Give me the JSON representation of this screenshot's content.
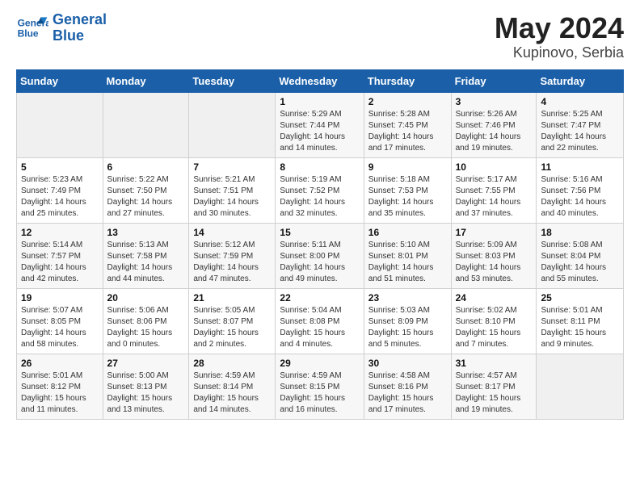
{
  "logo": {
    "name": "GeneralBlue",
    "line1": "General",
    "line2": "Blue"
  },
  "title": "May 2024",
  "subtitle": "Kupinovo, Serbia",
  "days_of_week": [
    "Sunday",
    "Monday",
    "Tuesday",
    "Wednesday",
    "Thursday",
    "Friday",
    "Saturday"
  ],
  "weeks": [
    [
      {
        "day": "",
        "info": ""
      },
      {
        "day": "",
        "info": ""
      },
      {
        "day": "",
        "info": ""
      },
      {
        "day": "1",
        "info": "Sunrise: 5:29 AM\nSunset: 7:44 PM\nDaylight: 14 hours and 14 minutes."
      },
      {
        "day": "2",
        "info": "Sunrise: 5:28 AM\nSunset: 7:45 PM\nDaylight: 14 hours and 17 minutes."
      },
      {
        "day": "3",
        "info": "Sunrise: 5:26 AM\nSunset: 7:46 PM\nDaylight: 14 hours and 19 minutes."
      },
      {
        "day": "4",
        "info": "Sunrise: 5:25 AM\nSunset: 7:47 PM\nDaylight: 14 hours and 22 minutes."
      }
    ],
    [
      {
        "day": "5",
        "info": "Sunrise: 5:23 AM\nSunset: 7:49 PM\nDaylight: 14 hours and 25 minutes."
      },
      {
        "day": "6",
        "info": "Sunrise: 5:22 AM\nSunset: 7:50 PM\nDaylight: 14 hours and 27 minutes."
      },
      {
        "day": "7",
        "info": "Sunrise: 5:21 AM\nSunset: 7:51 PM\nDaylight: 14 hours and 30 minutes."
      },
      {
        "day": "8",
        "info": "Sunrise: 5:19 AM\nSunset: 7:52 PM\nDaylight: 14 hours and 32 minutes."
      },
      {
        "day": "9",
        "info": "Sunrise: 5:18 AM\nSunset: 7:53 PM\nDaylight: 14 hours and 35 minutes."
      },
      {
        "day": "10",
        "info": "Sunrise: 5:17 AM\nSunset: 7:55 PM\nDaylight: 14 hours and 37 minutes."
      },
      {
        "day": "11",
        "info": "Sunrise: 5:16 AM\nSunset: 7:56 PM\nDaylight: 14 hours and 40 minutes."
      }
    ],
    [
      {
        "day": "12",
        "info": "Sunrise: 5:14 AM\nSunset: 7:57 PM\nDaylight: 14 hours and 42 minutes."
      },
      {
        "day": "13",
        "info": "Sunrise: 5:13 AM\nSunset: 7:58 PM\nDaylight: 14 hours and 44 minutes."
      },
      {
        "day": "14",
        "info": "Sunrise: 5:12 AM\nSunset: 7:59 PM\nDaylight: 14 hours and 47 minutes."
      },
      {
        "day": "15",
        "info": "Sunrise: 5:11 AM\nSunset: 8:00 PM\nDaylight: 14 hours and 49 minutes."
      },
      {
        "day": "16",
        "info": "Sunrise: 5:10 AM\nSunset: 8:01 PM\nDaylight: 14 hours and 51 minutes."
      },
      {
        "day": "17",
        "info": "Sunrise: 5:09 AM\nSunset: 8:03 PM\nDaylight: 14 hours and 53 minutes."
      },
      {
        "day": "18",
        "info": "Sunrise: 5:08 AM\nSunset: 8:04 PM\nDaylight: 14 hours and 55 minutes."
      }
    ],
    [
      {
        "day": "19",
        "info": "Sunrise: 5:07 AM\nSunset: 8:05 PM\nDaylight: 14 hours and 58 minutes."
      },
      {
        "day": "20",
        "info": "Sunrise: 5:06 AM\nSunset: 8:06 PM\nDaylight: 15 hours and 0 minutes."
      },
      {
        "day": "21",
        "info": "Sunrise: 5:05 AM\nSunset: 8:07 PM\nDaylight: 15 hours and 2 minutes."
      },
      {
        "day": "22",
        "info": "Sunrise: 5:04 AM\nSunset: 8:08 PM\nDaylight: 15 hours and 4 minutes."
      },
      {
        "day": "23",
        "info": "Sunrise: 5:03 AM\nSunset: 8:09 PM\nDaylight: 15 hours and 5 minutes."
      },
      {
        "day": "24",
        "info": "Sunrise: 5:02 AM\nSunset: 8:10 PM\nDaylight: 15 hours and 7 minutes."
      },
      {
        "day": "25",
        "info": "Sunrise: 5:01 AM\nSunset: 8:11 PM\nDaylight: 15 hours and 9 minutes."
      }
    ],
    [
      {
        "day": "26",
        "info": "Sunrise: 5:01 AM\nSunset: 8:12 PM\nDaylight: 15 hours and 11 minutes."
      },
      {
        "day": "27",
        "info": "Sunrise: 5:00 AM\nSunset: 8:13 PM\nDaylight: 15 hours and 13 minutes."
      },
      {
        "day": "28",
        "info": "Sunrise: 4:59 AM\nSunset: 8:14 PM\nDaylight: 15 hours and 14 minutes."
      },
      {
        "day": "29",
        "info": "Sunrise: 4:59 AM\nSunset: 8:15 PM\nDaylight: 15 hours and 16 minutes."
      },
      {
        "day": "30",
        "info": "Sunrise: 4:58 AM\nSunset: 8:16 PM\nDaylight: 15 hours and 17 minutes."
      },
      {
        "day": "31",
        "info": "Sunrise: 4:57 AM\nSunset: 8:17 PM\nDaylight: 15 hours and 19 minutes."
      },
      {
        "day": "",
        "info": ""
      }
    ]
  ]
}
